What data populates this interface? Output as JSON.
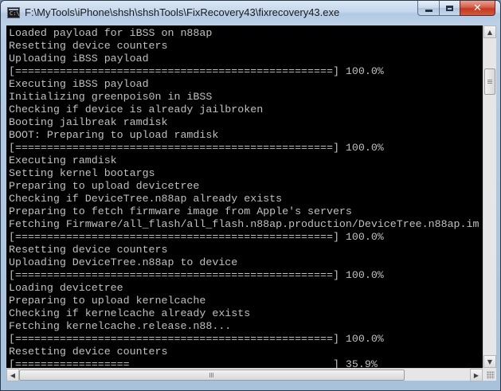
{
  "window": {
    "title": "F:\\MyTools\\iPhone\\shsh\\shshTools\\FixRecovery43\\fixrecovery43.exe",
    "icon": "console-app-icon",
    "icon_prompt": "C:\\",
    "close_glyph": "✕"
  },
  "caption_buttons": {
    "minimize": "minimize-icon",
    "maximize": "maximize-icon",
    "close": "close-icon"
  },
  "console": {
    "text_color": "#c0c0c0",
    "background": "#000000",
    "lines": [
      "Loaded payload for iBSS on n88ap",
      "Resetting device counters",
      "Uploading iBSS payload",
      "[==================================================] 100.0%",
      "Executing iBSS payload",
      "Initializing greenpois0n in iBSS",
      "Checking if device is already jailbroken",
      "Booting jailbreak ramdisk",
      "BOOT: Preparing to upload ramdisk",
      "[==================================================] 100.0%",
      "Executing ramdisk",
      "Setting kernel bootargs",
      "Preparing to upload devicetree",
      "Checking if DeviceTree.n88ap already exists",
      "Preparing to fetch firmware image from Apple's servers",
      "Fetching Firmware/all_flash/all_flash.n88ap.production/DeviceTree.n88ap.im",
      "[==================================================] 100.0%",
      "Resetting device counters",
      "Uploading DeviceTree.n88ap to device",
      "[==================================================] 100.0%",
      "Loading devicetree",
      "Preparing to upload kernelcache",
      "Checking if kernelcache already exists",
      "Fetching kernelcache.release.n88...",
      "[==================================================] 100.0%",
      "Resetting device counters",
      "[==================                                ] 35.9%"
    ]
  },
  "scrollbars": {
    "vertical": {
      "up_glyph": "▲",
      "down_glyph": "▼"
    },
    "horizontal": {
      "left_glyph": "◀",
      "right_glyph": "▶"
    }
  }
}
